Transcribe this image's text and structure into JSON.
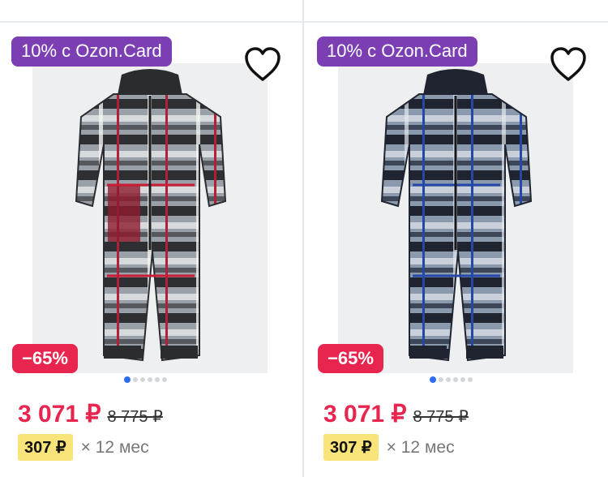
{
  "products": [
    {
      "promo_badge": "10% с Ozon.Card",
      "discount_badge": "−65%",
      "price": "3 071 ₽",
      "old_price": "8 775 ₽",
      "installment_price": "307 ₽",
      "installment_term": "× 12 мес",
      "image_icon": "snowsuit-red-plaid",
      "gallery_active_index": 1,
      "gallery_count": 6,
      "favorite_icon": "heart-outline-icon"
    },
    {
      "promo_badge": "10% с Ozon.Card",
      "discount_badge": "−65%",
      "price": "3 071 ₽",
      "old_price": "8 775 ₽",
      "installment_price": "307 ₽",
      "installment_term": "× 12 мес",
      "image_icon": "snowsuit-blue-plaid",
      "gallery_active_index": 1,
      "gallery_count": 6,
      "favorite_icon": "heart-outline-icon"
    }
  ],
  "colors": {
    "promo": "#7b3fb3",
    "discount": "#e8254e",
    "price": "#e8254e",
    "installment_bg": "#f8e479",
    "dot_active": "#2f6df0"
  }
}
